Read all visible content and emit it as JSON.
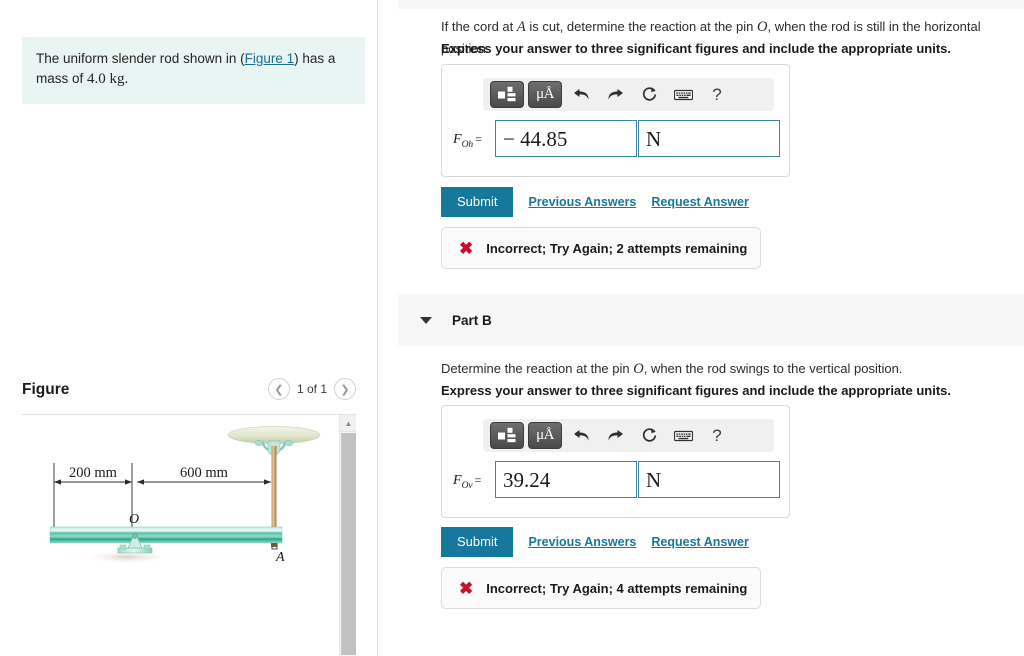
{
  "left": {
    "problem_text_pre": "The uniform slender rod shown in (",
    "figure_link": "Figure 1",
    "problem_text_post": ") has a mass of ",
    "mass": "4.0 kg.",
    "figure_title": "Figure",
    "figure_count": "1 of 1",
    "prev_icon": "chevron-left-icon",
    "next_icon": "chevron-right-icon",
    "diagram": {
      "dim_left": "200 mm",
      "dim_right": "600 mm",
      "pin_label": "O",
      "cord_label": "A"
    }
  },
  "parts": {
    "a": {
      "question": "If the cord at A is cut, determine the reaction at the pin O, when the rod is still in the horizontal position.",
      "question_lead": "If the cord at ",
      "var_a": "A",
      "question_mid": " is cut, determine the reaction at the pin ",
      "var_o": "O",
      "question_tail": ", when the rod is still in the horizontal position.",
      "instruction": "Express your answer to three significant figures and include the appropriate units.",
      "answer_label": "F",
      "answer_sub": "Oh",
      "equals": "=",
      "answer_value": "− 44.85",
      "answer_units": "N",
      "submit_label": "Submit",
      "previous_answers": "Previous Answers",
      "request_answer": "Request Answer",
      "feedback": "Incorrect; Try Again; 2 attempts remaining",
      "feedback_icon": "x-mark-icon"
    },
    "b": {
      "header_title": "Part B",
      "question_lead": "Determine the reaction at the pin ",
      "var_o": "O",
      "question_tail": ", when the rod swings to the vertical position.",
      "instruction": "Express your answer to three significant figures and include the appropriate units.",
      "answer_label": "F",
      "answer_sub": "Ov",
      "equals": "=",
      "answer_value": "39.24",
      "answer_units": "N",
      "submit_label": "Submit",
      "previous_answers": "Previous Answers",
      "request_answer": "Request Answer",
      "feedback": "Incorrect; Try Again; 4 attempts remaining",
      "feedback_icon": "x-mark-icon"
    }
  },
  "toolbar": {
    "template_icon": "math-template-icon",
    "units_label": "μÅ",
    "undo_icon": "undo-arrow-icon",
    "redo_icon": "redo-arrow-icon",
    "reset_icon": "reset-circle-icon",
    "keyboard_icon": "keyboard-icon",
    "help_label": "?"
  },
  "colors": {
    "accent_teal": "#17789d",
    "problem_box_bg": "#e8f5f3",
    "error_red": "#c8102e",
    "input_border": "#3c86a0",
    "part_header_bg": "#f7f7f7"
  }
}
